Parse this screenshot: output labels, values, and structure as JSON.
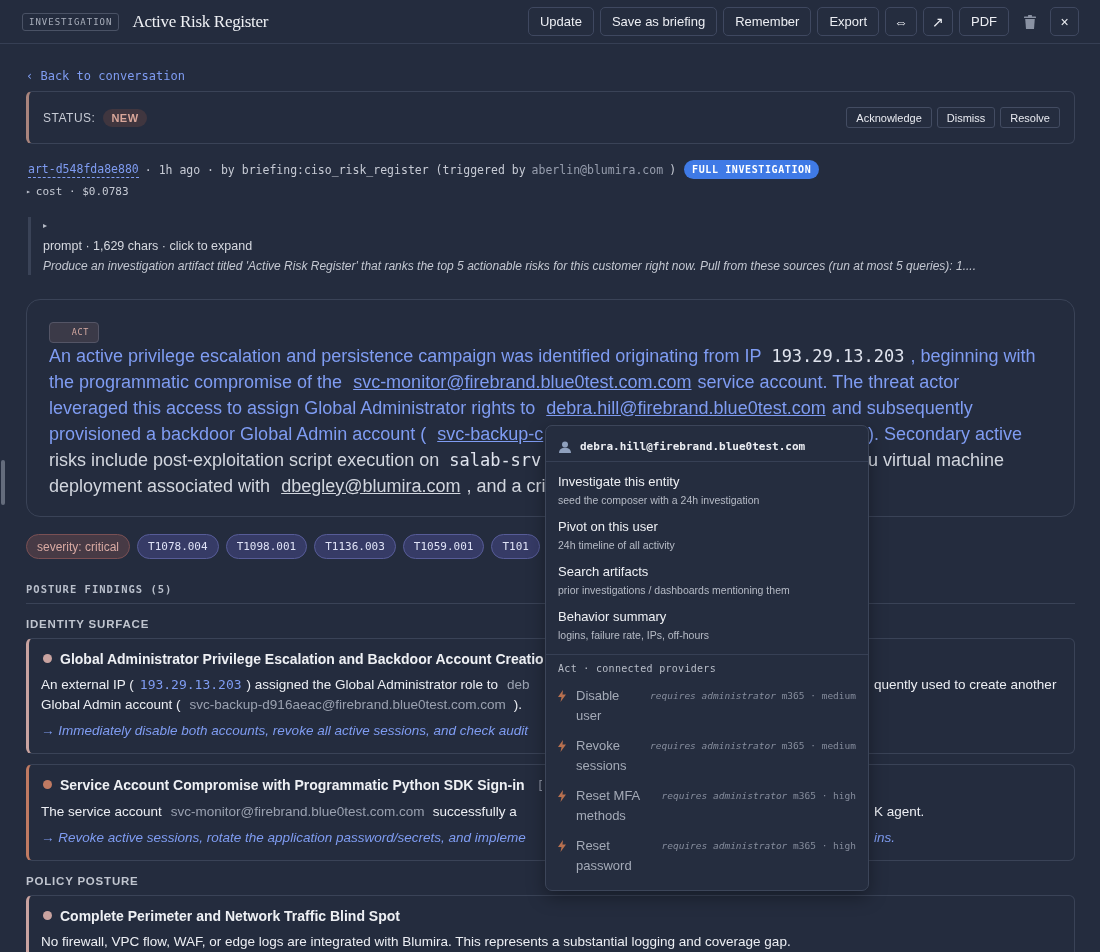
{
  "header": {
    "badge": "INVESTIGATION",
    "title": "Active Risk Register",
    "actions": [
      {
        "kind": "text",
        "label": "Update"
      },
      {
        "kind": "text",
        "label": "Save as briefing"
      },
      {
        "kind": "text",
        "label": "Remember"
      },
      {
        "kind": "text",
        "label": "Export"
      },
      {
        "kind": "glyph",
        "label": "⇔"
      },
      {
        "kind": "glyph",
        "label": "↗"
      },
      {
        "kind": "text",
        "label": "PDF"
      },
      {
        "kind": "trash"
      },
      {
        "kind": "glyph",
        "label": "×"
      }
    ]
  },
  "back_link": "‹ Back to conversation",
  "status": {
    "label": "STATUS:",
    "value": "NEW",
    "actions": [
      "Acknowledge",
      "Dismiss",
      "Resolve"
    ]
  },
  "meta": {
    "artifact_id": "art-d548fda8e880",
    "byline": "· 1h ago · by briefing:ciso_risk_register (triggered by",
    "trigger_user": "aberlin@blumira.com",
    "close": ")",
    "badge": "FULL INVESTIGATION"
  },
  "cost": {
    "toggle": "▸",
    "text": "cost · $0.0783"
  },
  "prompt": {
    "toggle": "▸",
    "summary": "prompt · 1,629 chars · click to expand",
    "text": "Produce an investigation artifact titled 'Active Risk Register' that ranks the top 5 actionable risks for this customer right now. Pull from these sources (run at most 5 queries): 1...."
  },
  "summary": {
    "badge": "ACT",
    "lines": [
      {
        "left": [
          {
            "kind": "lead",
            "text": "An active privilege escalation and persistence campaign was identified originating from IP"
          },
          {
            "kind": "code",
            "text": "193.29.13.203"
          },
          {
            "kind": "lead",
            "text": ", beginning with"
          }
        ]
      },
      {
        "left": [
          {
            "kind": "lead",
            "text": "the programmatic compromise of the"
          },
          {
            "kind": "lead-link",
            "text": "svc-monitor@firebrand.blue0test.com.com"
          },
          {
            "kind": "lead",
            "text": "service account. The threat actor"
          }
        ]
      },
      {
        "left": [
          {
            "kind": "lead",
            "text": "leveraged this access to assign Global Administrator rights to"
          },
          {
            "kind": "lead-link",
            "text": "debra.hill@firebrand.blue0test.com"
          },
          {
            "kind": "lead",
            "text": "and subsequently"
          }
        ]
      },
      {
        "left": [
          {
            "kind": "lead",
            "text": "provisioned a backdoor Global Admin account ("
          },
          {
            "kind": "lead-link",
            "text": "svc-backup-c"
          }
        ],
        "right": [
          {
            "kind": "lead",
            "text": "). Secondary active"
          }
        ]
      },
      {
        "left": [
          {
            "kind": "text",
            "text": "risks include post-exploitation script execution on"
          },
          {
            "kind": "code",
            "text": "salab-srv"
          }
        ],
        "right": [
          {
            "kind": "text",
            "text": "u virtual machine"
          }
        ]
      },
      {
        "left": [
          {
            "kind": "text",
            "text": "deployment associated with"
          },
          {
            "kind": "link",
            "text": "dbegley@blumira.com"
          },
          {
            "kind": "text",
            "text": ", and a cri"
          }
        ]
      }
    ]
  },
  "tags": [
    {
      "kind": "severity",
      "label": "severity: critical"
    },
    {
      "kind": "technique",
      "label": "T1078.004"
    },
    {
      "kind": "technique",
      "label": "T1098.001"
    },
    {
      "kind": "technique",
      "label": "T1136.003"
    },
    {
      "kind": "technique",
      "label": "T1059.001"
    },
    {
      "kind": "technique",
      "label": "T101"
    }
  ],
  "findings_heading": "POSTURE FINDINGS (5)",
  "groups": [
    {
      "title": "IDENTITY SURFACE",
      "findings": [
        {
          "color": "#c9a3a0",
          "title": [
            {
              "kind": "title",
              "text": "Global Administrator Privilege Escalation and Backdoor Account Creatio"
            }
          ],
          "lines": [
            {
              "left": [
                {
                  "kind": "text",
                  "text": "An external IP ("
                },
                {
                  "kind": "code",
                  "text": "193.29.13.203"
                },
                {
                  "kind": "text",
                  "text": ") assigned the Global Administrator role to"
                },
                {
                  "kind": "muted",
                  "text": "deb"
                }
              ],
              "right": [
                {
                  "kind": "text",
                  "text": "quently used to create another"
                }
              ]
            },
            {
              "left": [
                {
                  "kind": "text",
                  "text": "Global Admin account ("
                },
                {
                  "kind": "muted",
                  "text": "svc-backup-d916aeac@firebrand.blue0test.com.com"
                },
                {
                  "kind": "text",
                  "text": ")."
                }
              ]
            }
          ],
          "action": [
            {
              "left": [
                {
                  "kind": "action",
                  "text": "→ Immediately disable both accounts, revoke all active sessions, and check audit"
                }
              ]
            }
          ]
        },
        {
          "color": "#c07a62",
          "title": [
            {
              "kind": "title",
              "text": "Service Account Compromise with Programmatic Python SDK Sign-in"
            },
            {
              "kind": "muted",
              "text": "["
            }
          ],
          "lines": [
            {
              "left": [
                {
                  "kind": "text",
                  "text": "The service account"
                },
                {
                  "kind": "muted",
                  "text": "svc-monitor@firebrand.blue0test.com.com"
                },
                {
                  "kind": "text",
                  "text": "successfully a"
                }
              ],
              "right": [
                {
                  "kind": "text",
                  "text": "K agent."
                }
              ]
            }
          ],
          "action": [
            {
              "left": [
                {
                  "kind": "action",
                  "text": "→ Revoke active sessions, rotate the application password/secrets, and impleme"
                }
              ],
              "right": [
                {
                  "kind": "action",
                  "text": "ins."
                }
              ]
            }
          ]
        }
      ]
    },
    {
      "title": "POLICY POSTURE",
      "findings": [
        {
          "color": "#c9a3a0",
          "title": [
            {
              "kind": "title",
              "text": "Complete Perimeter and Network Traffic Blind Spot"
            }
          ],
          "lines": [
            {
              "left": [
                {
                  "kind": "text",
                  "text": "No firewall, VPC flow, WAF, or edge logs are integrated with Blumira. This represents a substantial logging and coverage gap."
                }
              ]
            }
          ]
        }
      ]
    }
  ],
  "entity_menu": {
    "entity": "debra.hill@firebrand.blue0test.com",
    "items": [
      {
        "title": "Investigate this entity",
        "subtitle": "seed the composer with a 24h investigation"
      },
      {
        "title": "Pivot on this user",
        "subtitle": "24h timeline of all activity"
      },
      {
        "title": "Search artifacts",
        "subtitle": "prior investigations / dashboards mentioning them"
      },
      {
        "title": "Behavior summary",
        "subtitle": "logins, failure rate, IPs, off-hours"
      }
    ],
    "section": "Act · connected providers",
    "actions": [
      {
        "label": "Disable user",
        "meta": "*requires administrator* m365 · medium",
        "disabled": true
      },
      {
        "label": "Revoke sessions",
        "meta": "*requires administrator* m365 · medium",
        "disabled": true
      },
      {
        "label": "Reset MFA methods",
        "meta": "*requires administrator* m365 · high",
        "disabled": true
      },
      {
        "label": "Reset password",
        "meta": "*requires administrator* m365 · high",
        "disabled": true
      }
    ]
  }
}
